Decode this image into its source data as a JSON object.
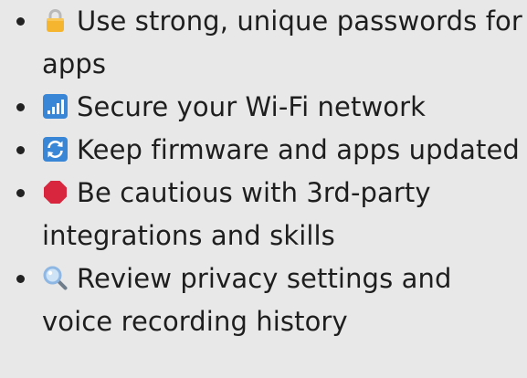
{
  "tips": [
    {
      "icon": "lock-icon",
      "text": "Use strong, unique passwords for apps"
    },
    {
      "icon": "signal-bars-icon",
      "text": "Secure your Wi-Fi network"
    },
    {
      "icon": "refresh-arrows-icon",
      "text": "Keep firmware and apps updated"
    },
    {
      "icon": "stop-sign-icon",
      "text": "Be cautious with 3rd-party integrations and skills"
    },
    {
      "icon": "magnifying-glass-icon",
      "text": "Review privacy settings and voice recording history"
    }
  ],
  "colors": {
    "text": "#1e1e1e",
    "background": "#e8e8e8",
    "lock": "#f5b52e",
    "signal_tile": "#3a86d6",
    "refresh_tile": "#3a86d6",
    "stop": "#d7263d",
    "magnifier": "#8fb7e3"
  }
}
